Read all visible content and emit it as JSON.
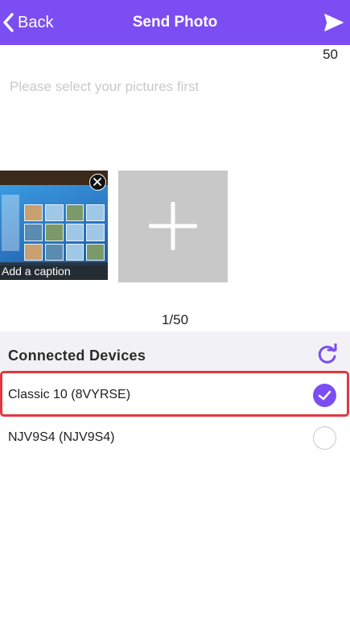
{
  "header": {
    "back_label": "Back",
    "title": "Send Photo",
    "background_color": "#7b4df2"
  },
  "compose": {
    "char_count": "50",
    "placeholder": "Please select your pictures first",
    "value": ""
  },
  "photos": [
    {
      "caption": "Add a caption"
    }
  ],
  "photo_counter": "1/50",
  "devices": {
    "title": "Connected Devices",
    "items": [
      {
        "label": "Classic 10 (8VYRSE)",
        "selected": true
      },
      {
        "label": "NJV9S4 (NJV9S4)",
        "selected": false
      }
    ]
  },
  "icons": {
    "back": "chevron-left-icon",
    "send": "paper-plane-icon",
    "remove": "close-icon",
    "add": "plus-icon",
    "refresh": "refresh-icon",
    "selected": "checkmark-icon"
  },
  "colors": {
    "accent": "#7b4df2",
    "highlight": "#e0383f"
  }
}
